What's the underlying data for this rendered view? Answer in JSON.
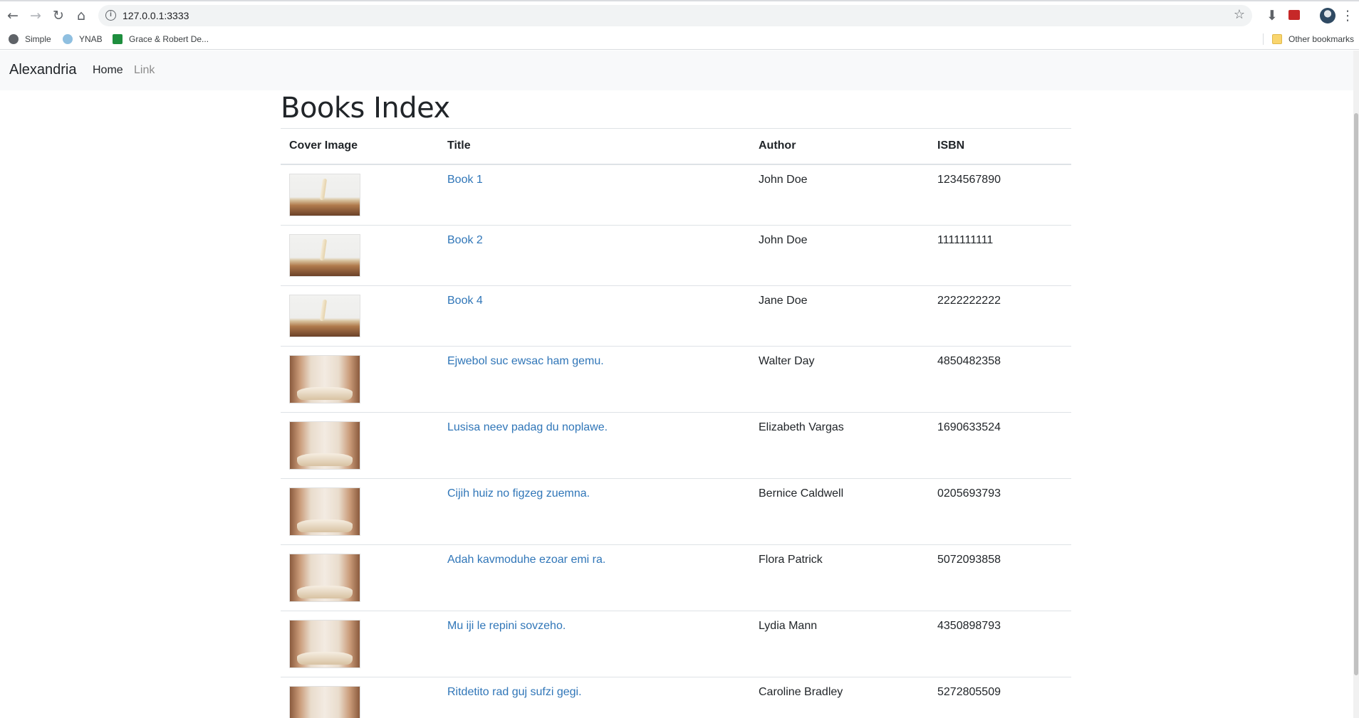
{
  "browser": {
    "url": "127.0.0.1:3333",
    "bookmarks": [
      "Simple",
      "YNAB",
      "Grace & Robert De..."
    ],
    "other_bookmarks": "Other bookmarks"
  },
  "navbar": {
    "brand": "Alexandria",
    "links": [
      "Home",
      "Link"
    ]
  },
  "page": {
    "title": "Books Index",
    "columns": [
      "Cover Image",
      "Title",
      "Author",
      "ISBN"
    ],
    "rows": [
      {
        "title": "Book 1",
        "author": "John Doe",
        "isbn": "1234567890"
      },
      {
        "title": "Book 2",
        "author": "John Doe",
        "isbn": "1111111111"
      },
      {
        "title": "Book 4",
        "author": "Jane Doe",
        "isbn": "2222222222"
      },
      {
        "title": "Ejwebol suc ewsac ham gemu.",
        "author": "Walter Day",
        "isbn": "4850482358"
      },
      {
        "title": "Lusisa neev padag du noplawe.",
        "author": "Elizabeth Vargas",
        "isbn": "1690633524"
      },
      {
        "title": "Cijih huiz no figzeg zuemna.",
        "author": "Bernice Caldwell",
        "isbn": "0205693793"
      },
      {
        "title": "Adah kavmoduhe ezoar emi ra.",
        "author": "Flora Patrick",
        "isbn": "5072093858"
      },
      {
        "title": "Mu iji le repini sovzeho.",
        "author": "Lydia Mann",
        "isbn": "4350898793"
      },
      {
        "title": "Ritdetito rad guj sufzi gegi.",
        "author": "Caroline Bradley",
        "isbn": "5272805509"
      }
    ]
  },
  "colors": {
    "link": "#3076b8",
    "navbar_bg": "#f8f9fa",
    "muted_link": "#8c8c8c"
  },
  "icons": [
    "back-arrow-icon",
    "forward-arrow-icon",
    "reload-icon",
    "home-icon",
    "info-icon",
    "star-icon",
    "download-icon",
    "extension-icon",
    "profile-avatar-icon",
    "kebab-menu-icon",
    "globe-icon",
    "ynab-icon",
    "sheets-icon",
    "folder-icon"
  ]
}
